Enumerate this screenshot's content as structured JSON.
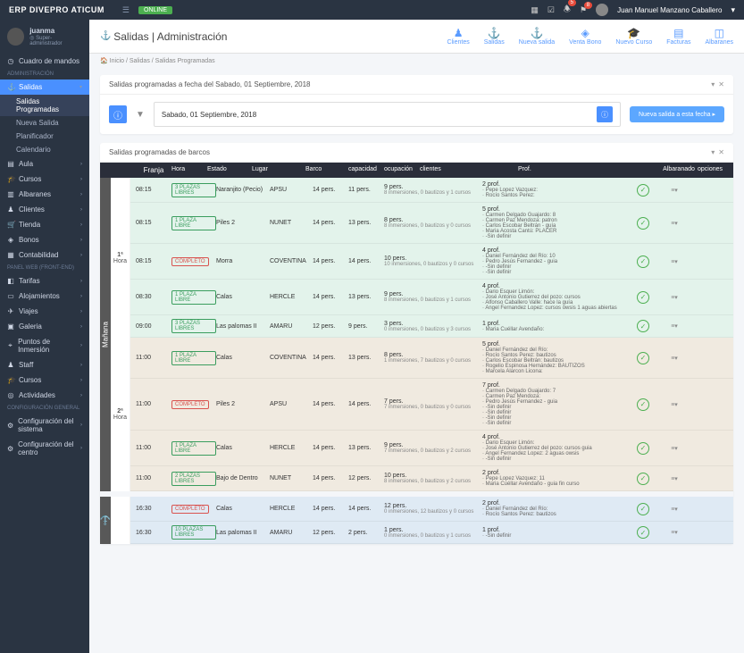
{
  "app": {
    "brand": "ERP DIVEPRO ATICUM",
    "online": "ONLINE"
  },
  "user": {
    "name": "juanma",
    "role": "Super-administrador",
    "full_name": "Juan Manuel Manzano Caballero"
  },
  "notifications": {
    "n1": "5",
    "n2": "8"
  },
  "sidebar": {
    "dashboard": "Cuadro de mandos",
    "sec_admin": "ADMINISTRACIÓN",
    "salidas": "Salidas",
    "sub_prog": "Salidas Programadas",
    "sub_nueva": "Nueva Salida",
    "sub_plan": "Planificador",
    "sub_cal": "Calendario",
    "aula": "Aula",
    "cursos": "Cursos",
    "albaranes": "Albaranes",
    "clientes": "Clientes",
    "tienda": "Tienda",
    "bonos": "Bonos",
    "contabilidad": "Contabilidad",
    "sec_panel": "PANEL WEB (FRONT-END)",
    "tarifas": "Tarifas",
    "alojamientos": "Alojamientos",
    "viajes": "Viajes",
    "galeria": "Galeria",
    "puntos": "Puntos de Inmersión",
    "staff": "Staff",
    "cursos2": "Cursos",
    "actividades": "Actividades",
    "sec_conf": "CONFIGURACIÓN GENERAL",
    "conf_sistema": "Configuración del sistema",
    "conf_centro": "Configuración del centro"
  },
  "page": {
    "title": "Salidas | Administración",
    "actions": {
      "clientes": "Clientes",
      "salidas": "Salidas",
      "nueva_salida": "Nueva salida",
      "venta_bono": "Venta Bono",
      "nuevo_curso": "Nuevo Curso",
      "facturas": "Facturas",
      "albaranes": "Albaranes"
    },
    "bc_inicio": "Inicio",
    "bc_salidas": "Salidas",
    "bc_current": "Salidas Programadas"
  },
  "datepanel": {
    "title": "Salidas programadas a fecha del Sabado, 01 Septiembre, 2018",
    "date_input": "Sabado, 01 Septiembre, 2018",
    "new_btn": "Nueva salida a esta fecha ▸"
  },
  "table": {
    "title2": "Salidas programadas de barcos",
    "h_franja": "Franja",
    "h_hora": "Hora",
    "h_estado": "Estado",
    "h_lugar": "Lugar",
    "h_barco": "Barco",
    "h_cap": "capacidad",
    "h_ocu": "ocupación",
    "h_cli": "clientes",
    "h_prof": "Prof.",
    "h_alb": "Albaranado",
    "h_opt": "opciones"
  },
  "period_manana": "Mañana",
  "slot1": "1ª Hora",
  "slot2": "2ª Hora",
  "rows": [
    {
      "cls": "green",
      "hora": "08:15",
      "estado": "3 PLAZAS LIBRES",
      "lugar": "Naranjito (Pecio)",
      "barco": "APSU",
      "cap": "14 pers.",
      "ocu": "11 pers.",
      "cli": "9 pers.",
      "cli2": "8 inmersiones, 0 bautizos y 1 cursos",
      "prof_n": "2 prof.",
      "prof_list": [
        "Pepe Lopez Vazquez:",
        "Rocío Santos Perez:"
      ]
    },
    {
      "cls": "green",
      "hora": "08:15",
      "estado": "1 PLAZA LIBRE",
      "lugar": "Piles 2",
      "barco": "NUNET",
      "cap": "14 pers.",
      "ocu": "13 pers.",
      "cli": "8 pers.",
      "cli2": "8 inmersiones, 0 bautizos y 0 cursos",
      "prof_n": "5 prof.",
      "prof_list": [
        "Carmen Delgado Guajardo: 8",
        "Carmen Paz Mendoza: patron",
        "Carlos Escobar Beltrán - guía",
        "Maria Acosta Cantú: PLACER",
        "-Sin definir"
      ]
    },
    {
      "cls": "green",
      "hora": "08:15",
      "estado": "COMPLETO",
      "full": true,
      "lugar": "Morra",
      "barco": "COVENTINA",
      "cap": "14 pers.",
      "ocu": "14 pers.",
      "cli": "10 pers.",
      "cli2": "10 inmersiones, 0 bautizos y 0 cursos",
      "prof_n": "4 prof.",
      "prof_list": [
        "Daniel Fernández del Río: 10",
        "Pedro Jesús Fernandez - guia",
        "-Sin definir",
        "-Sin definir"
      ]
    },
    {
      "cls": "green",
      "hora": "08:30",
      "estado": "1 PLAZA LIBRE",
      "lugar": "Calas",
      "barco": "HERCLE",
      "cap": "14 pers.",
      "ocu": "13 pers.",
      "cli": "9 pers.",
      "cli2": "8 inmersiones, 0 bautizos y 1 cursos",
      "prof_n": "4 prof.",
      "prof_list": [
        "Dario Esquer Limón:",
        "José Antonio Gutierrez del pozo: cursos",
        "Alfonso Caballero Valle: hace la guía",
        "Angel Fernandez Lopez: cursos owsis 1 aguas abiertas"
      ]
    },
    {
      "cls": "green",
      "hora": "09:00",
      "estado": "3 PLAZAS LIBRES",
      "lugar": "Las palomas II",
      "barco": "AMARU",
      "cap": "12 pers.",
      "ocu": "9 pers.",
      "cli": "3 pers.",
      "cli2": "0 inmersiones, 0 bautizos y 3 cursos",
      "prof_n": "1 prof.",
      "prof_list": [
        "Maria Cuéllar Avendaño:"
      ]
    },
    {
      "cls": "brown",
      "hora": "11:00",
      "estado": "1 PLAZA LIBRE",
      "lugar": "Calas",
      "barco": "COVENTINA",
      "cap": "14 pers.",
      "ocu": "13 pers.",
      "cli": "8 pers.",
      "cli2": "1 inmersiones, 7 bautizos y 0 cursos",
      "prof_n": "5 prof.",
      "prof_list": [
        "Daniel Fernández del Río:",
        "Rocío Santos Perez: bautizos",
        "Carlos Escobar Beltrán: bautizos",
        "Rogelio Espinosa Hernández: BAUTIZOS",
        "Marcela Alarcon Licona:"
      ]
    },
    {
      "cls": "brown",
      "hora": "11:00",
      "estado": "COMPLETO",
      "full": true,
      "lugar": "Piles 2",
      "barco": "APSU",
      "cap": "14 pers.",
      "ocu": "14 pers.",
      "cli": "7 pers.",
      "cli2": "7 inmersiones, 0 bautizos y 0 cursos",
      "prof_n": "7 prof.",
      "prof_list": [
        "Carmen Delgado Guajardo: 7",
        "Carmen Paz Mendoza:",
        "Pedro Jesús Fernandez - guia",
        "-Sin definir",
        "-Sin definir",
        "-Sin definir",
        "-Sin definir"
      ]
    },
    {
      "cls": "brown",
      "hora": "11:00",
      "estado": "1 PLAZA LIBRE",
      "lugar": "Calas",
      "barco": "HERCLE",
      "cap": "14 pers.",
      "ocu": "13 pers.",
      "cli": "9 pers.",
      "cli2": "7 inmersiones, 0 bautizos y 2 cursos",
      "prof_n": "4 prof.",
      "prof_list": [
        "Dario Esquer Limón:",
        "José Antonio Gutierrez del pozo: cursos guia",
        "Angel Fernandez Lopez: 2 aguas owsis",
        "-Sin definir"
      ]
    },
    {
      "cls": "brown",
      "hora": "11:00",
      "estado": "2 PLAZAS LIBRES",
      "lugar": "Bajo de Dentro",
      "barco": "NUNET",
      "cap": "14 pers.",
      "ocu": "12 pers.",
      "cli": "10 pers.",
      "cli2": "8 inmersiones, 0 bautizos y 2 cursos",
      "prof_n": "2 prof.",
      "prof_list": [
        "Pepe Lopez Vazquez: 11",
        "Maria Cuéllar Avendaño - guia fin curso"
      ]
    },
    {
      "cls": "blue",
      "hora": "16:30",
      "estado": "COMPLETO",
      "full": true,
      "lugar": "Calas",
      "barco": "HERCLE",
      "cap": "14 pers.",
      "ocu": "14 pers.",
      "cli": "12 pers.",
      "cli2": "0 inmersiones, 12 bautizos y 0 cursos",
      "prof_n": "2 prof.",
      "prof_list": [
        "Daniel Fernández del Río:",
        "Rocío Santos Perez: bautizos"
      ]
    },
    {
      "cls": "blue",
      "hora": "16:30",
      "estado": "10 PLAZAS LIBRES",
      "lugar": "Las palomas II",
      "barco": "AMARU",
      "cap": "12 pers.",
      "ocu": "2 pers.",
      "cli": "1 pers.",
      "cli2": "0 inmersiones, 0 bautizos y 1 cursos",
      "prof_n": "1 prof.",
      "prof_list": [
        "-Sin definir"
      ]
    }
  ]
}
